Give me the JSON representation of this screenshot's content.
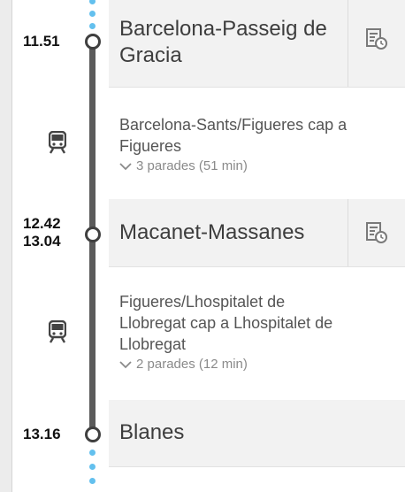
{
  "colors": {
    "rail": "#5b5b5b",
    "dots": "#63c0ee",
    "stop_background": "#f2f2f2",
    "text": "#3d3d3d",
    "muted": "#8a8a8a"
  },
  "journey": {
    "stops": [
      {
        "times": [
          "11.51"
        ],
        "name_lines": [
          "Barcelona-Passeig de",
          "Gracia"
        ],
        "icon": "schedule-clock-icon"
      },
      {
        "times": [
          "12.42",
          "13.04"
        ],
        "name_lines": [
          "Macanet-Massanes"
        ],
        "icon": "schedule-clock-icon"
      },
      {
        "times": [
          "13.16"
        ],
        "name_lines": [
          "Blanes"
        ],
        "icon": null
      }
    ],
    "segments": [
      {
        "icon": "train-icon",
        "direction_lines": [
          "Barcelona-Sants/Figueres cap a",
          "Figueres"
        ],
        "stops_label": "3 parades (51 min)",
        "toggle_icon": "chevron-down-icon"
      },
      {
        "icon": "train-icon",
        "direction_lines": [
          "Figueres/Lhospitalet de",
          "Llobregat cap a Lhospitalet de",
          "Llobregat"
        ],
        "stops_label": "2 parades (12 min)",
        "toggle_icon": "chevron-down-icon"
      }
    ]
  }
}
